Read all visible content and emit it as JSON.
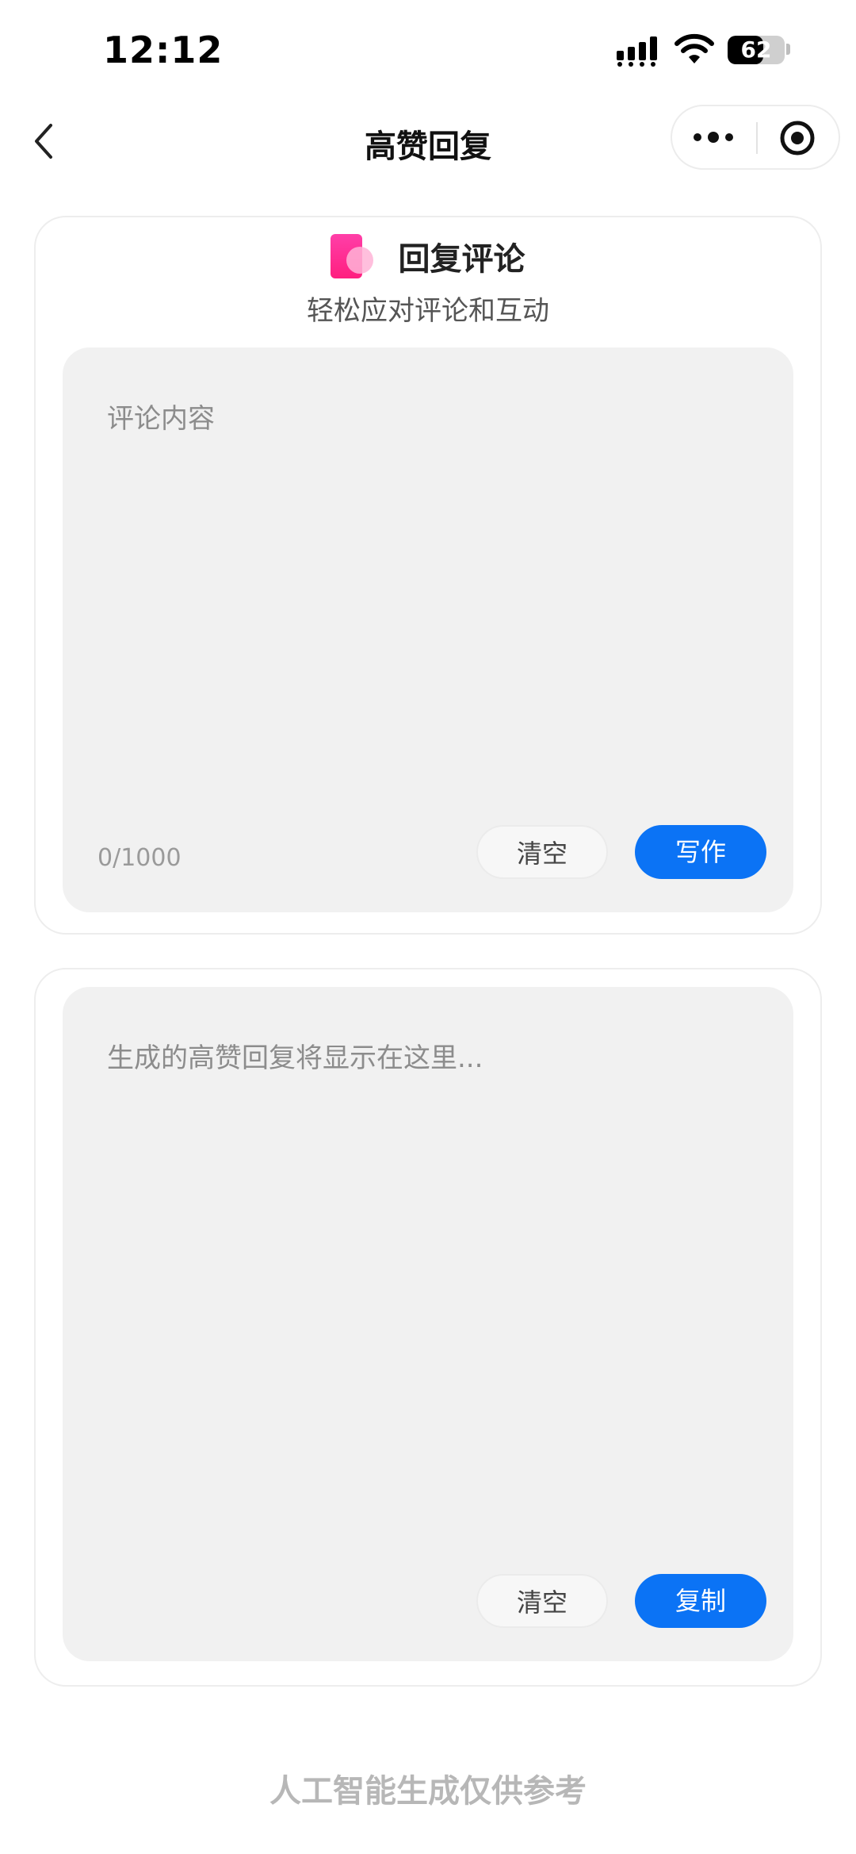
{
  "status_bar": {
    "time": "12:12",
    "battery_percent": 62,
    "battery_label": "62"
  },
  "nav": {
    "title": "高赞回复",
    "back_icon": "chevron-left-icon",
    "more_icon": "more-dots-icon",
    "target_icon": "target-circle-icon"
  },
  "comment_card": {
    "title": "回复评论",
    "subtitle": "轻松应对评论和互动",
    "input_placeholder": "评论内容",
    "counter": "0/1000",
    "clear_label": "清空",
    "write_label": "写作"
  },
  "result_card": {
    "placeholder": "生成的高赞回复将显示在这里...",
    "clear_label": "清空",
    "copy_label": "复制"
  },
  "footer": {
    "note": "人工智能生成仅供参考"
  },
  "colors": {
    "primary": "#0b73f5",
    "input_bg": "#f1f1f1",
    "icon_pink": "#ff2f92"
  }
}
